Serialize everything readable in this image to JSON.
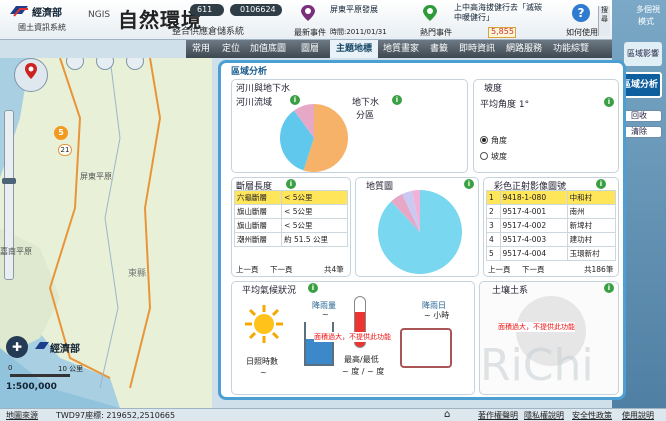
{
  "header": {
    "org": "經濟部",
    "org_sub": "國土資訊系統",
    "ngis": "NGIS",
    "app_title": "自然環境",
    "app_subtitle": "整合供應倉儲系統",
    "num_left": "611",
    "num_right": "0106624",
    "latest_event_label": "最新事件",
    "latest_event_value": "屏東平原發展",
    "time_label": "時間:2011/01/31",
    "hot_event_label": "熱門事件",
    "hot_event_value": "上中高海拔健行去「滅碳中暖健行」",
    "hot_count": "5,855",
    "howto_label": "如何使用",
    "howto_side": "搜尋"
  },
  "menu": [
    "常用",
    "定位",
    "加值底圖",
    "圖層",
    "主題地標",
    "地質畫家",
    "書籤",
    "即時資訊",
    "網路服務",
    "功能綜覽"
  ],
  "menu_active_index": 4,
  "map": {
    "labels": [
      "屏東平原",
      "東縣",
      "嘉南平原"
    ],
    "route_number": "21",
    "marker_number": "5",
    "logo_text": "經濟部",
    "scale_text": "1:500,000",
    "scale_zero": "0",
    "scale_ten": "10 公里"
  },
  "status": {
    "map_source": "地圖來源",
    "coords": "TWD97座標: 219652,2510665",
    "links": [
      "著作權聲明",
      "隱私權說明",
      "安全性政策",
      "使用說明"
    ]
  },
  "right": {
    "top_label_1": "多個視",
    "top_label_2": "模式",
    "tab_label": "區域分析",
    "side_label": "區域影響",
    "btn_bookmark": "回收",
    "btn_clear": "清除"
  },
  "panel": {
    "title": "區域分析",
    "river_title": "河川與地下水",
    "river_basin": "河川流域",
    "groundwater": "地下水",
    "groundwater_sub": "分區",
    "slope_title": "坡度",
    "slope_avg": "平均角度 1°",
    "slope_opt_angle": "角度",
    "slope_opt_grade": "坡度",
    "fault_title": "斷層長度",
    "fault_rows": [
      [
        "六龜斷層",
        "< 5公里"
      ],
      [
        "旗山斷層",
        "< 5公里"
      ],
      [
        "旗山斷層",
        "< 5公里"
      ],
      [
        "潮州斷層",
        "約 51.5 公里"
      ]
    ],
    "fault_prev": "上一頁",
    "fault_next": "下一頁",
    "fault_total": "共4筆",
    "geo_title": "地質圖",
    "img_title": "彩色正射影像圖號",
    "img_rows": [
      [
        "1",
        "9418-1-080",
        "中和村"
      ],
      [
        "2",
        "9517-4-001",
        "南州"
      ],
      [
        "3",
        "9517-4-002",
        "新埤村"
      ],
      [
        "4",
        "9517-4-003",
        "建功村"
      ],
      [
        "5",
        "9517-4-004",
        "玉環新村"
      ]
    ],
    "img_prev": "上一頁",
    "img_next": "下一頁",
    "img_total": "共186筆",
    "weather_title": "平均氣候狀況",
    "rain_label": "降雨量",
    "rain_val": "~",
    "rain_days": "降雨日",
    "rain_days_val": "~ 小時",
    "sun_label": "日照時數",
    "sun_val": "~",
    "temp_label": "最高/最低",
    "temp_val": "~ 度 / ~ 度",
    "overlay_msg": "面積過大，不提供此功能",
    "soil_title": "土壤土系",
    "soil_msg": "面積過大，不提供此功能",
    "watermark": "RiChi"
  },
  "colors": {
    "pie_orange": "#f7b26a",
    "pie_blue": "#5fc8ec",
    "pie_pink": "#e7a8c8",
    "pie_maroon": "#c0526e",
    "pie_slate": "#5a80b0",
    "pie_cyan": "#7ad7f0",
    "panel_border": "#4b9fd3",
    "highlight_row": "#ffe55a",
    "alert_red": "#e11111"
  }
}
